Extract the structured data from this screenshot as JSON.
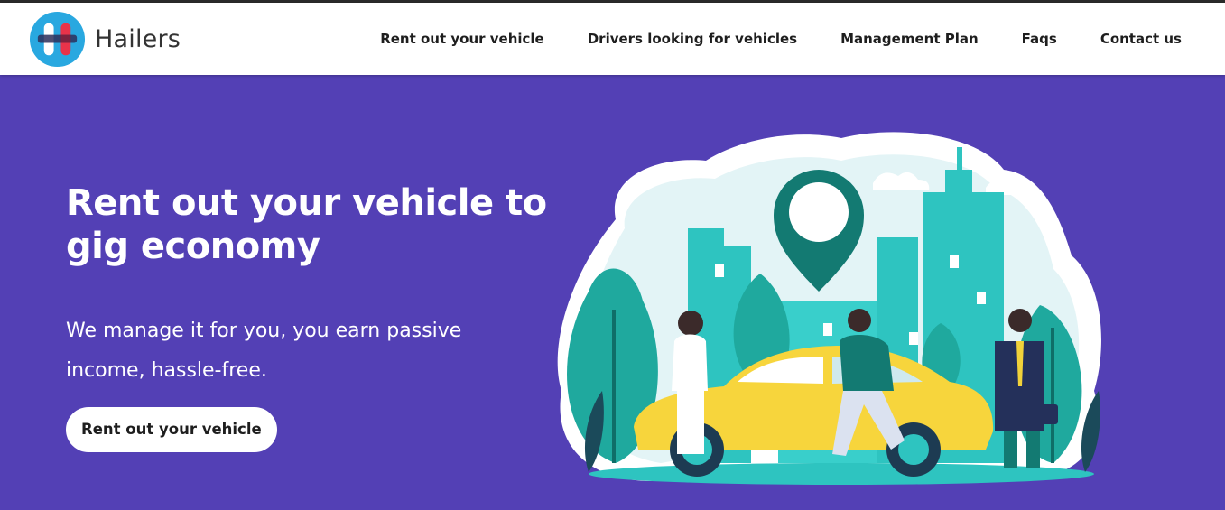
{
  "brand": {
    "name": "Hailers",
    "logo_icon": "hailers-logo-icon"
  },
  "nav": {
    "items": [
      {
        "label": "Rent out your vehicle"
      },
      {
        "label": "Drivers looking for vehicles"
      },
      {
        "label": "Management Plan"
      },
      {
        "label": "Faqs"
      },
      {
        "label": "Contact us"
      }
    ]
  },
  "hero": {
    "title": "Rent out your vehicle to gig economy",
    "subtitle": "We manage it for you, you earn passive income, hassle-free.",
    "cta_label": "Rent out your vehicle",
    "illustration": "city-car-rental-illustration"
  },
  "colors": {
    "hero_bg": "#5340b5",
    "accent_teal": "#2fc0b8",
    "car_yellow": "#f7d53c",
    "logo_blue": "#29a8e0",
    "logo_red": "#e8334a"
  }
}
